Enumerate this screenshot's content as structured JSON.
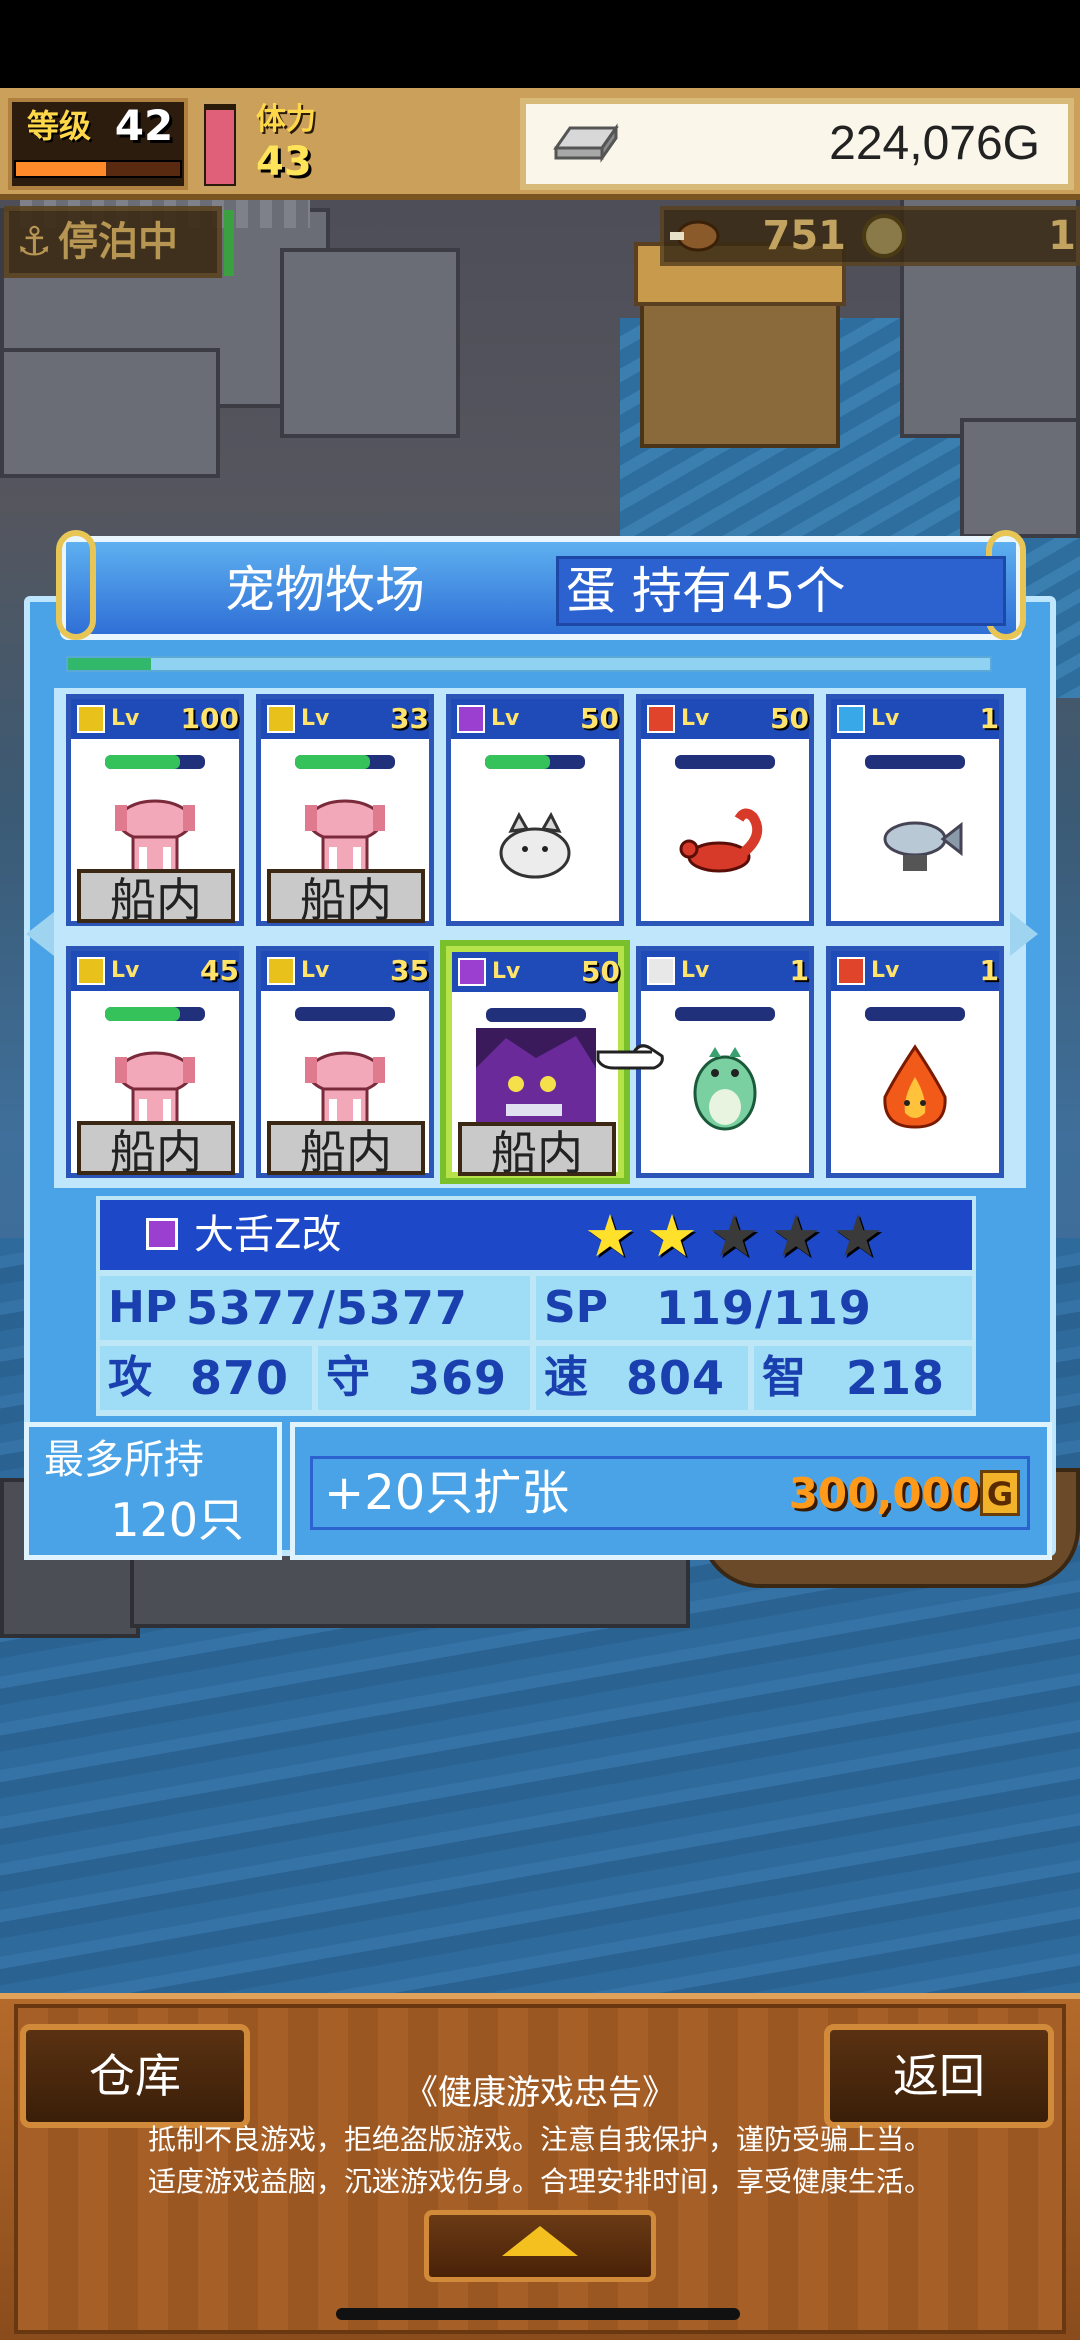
{
  "hud": {
    "level_label": "等级",
    "level_value": "42",
    "level_progress": 0.55,
    "hp_fill": 0.95,
    "stamina_label": "体力",
    "stamina_value": "43",
    "gold_value": "224,076G",
    "dock_status": "停泊中",
    "food_value": "751",
    "coin_value": "1"
  },
  "panel": {
    "title": "宠物牧场",
    "eggs_text": "蛋 持有45个",
    "page_progress": 0.09
  },
  "cards": [
    {
      "element": "gold",
      "lv_label": "Lv",
      "lv": "100",
      "hp": 0.75,
      "sprite": "pink-axolotl",
      "ship_label": "船内",
      "selected": false
    },
    {
      "element": "gold",
      "lv_label": "Lv",
      "lv": "33",
      "hp": 0.75,
      "sprite": "pink-axolotl",
      "ship_label": "船内",
      "selected": false
    },
    {
      "element": "purple",
      "lv_label": "Lv",
      "lv": "50",
      "hp": 0.65,
      "sprite": "white-slime",
      "ship_label": "",
      "selected": false
    },
    {
      "element": "red",
      "lv_label": "Lv",
      "lv": "50",
      "hp": 0,
      "sprite": "red-scorpion",
      "ship_label": "",
      "selected": false
    },
    {
      "element": "blue",
      "lv_label": "Lv",
      "lv": "1",
      "hp": 0,
      "sprite": "silver-fish",
      "ship_label": "",
      "selected": false
    },
    {
      "element": "gold",
      "lv_label": "Lv",
      "lv": "45",
      "hp": 0.75,
      "sprite": "pink-axolotl",
      "ship_label": "船内",
      "selected": false
    },
    {
      "element": "gold",
      "lv_label": "Lv",
      "lv": "35",
      "hp": 0,
      "sprite": "pink-axolotl",
      "ship_label": "船内",
      "selected": false
    },
    {
      "element": "purple",
      "lv_label": "Lv",
      "lv": "50",
      "hp": 0,
      "sprite": "purple-dragon",
      "ship_label": "船内",
      "selected": true
    },
    {
      "element": "white",
      "lv_label": "Lv",
      "lv": "1",
      "hp": 0,
      "sprite": "green-dino",
      "ship_label": "",
      "selected": false
    },
    {
      "element": "red",
      "lv_label": "Lv",
      "lv": "1",
      "hp": 0,
      "sprite": "fire-spirit",
      "ship_label": "",
      "selected": false
    }
  ],
  "info": {
    "name": "大舌Z改",
    "stars_filled": 2,
    "stars_total": 5,
    "hp_label": "HP",
    "hp_value": "5377/5377",
    "sp_label": "SP",
    "sp_value": "119/119",
    "atk_label": "攻",
    "atk_value": "870",
    "def_label": "守",
    "def_value": "369",
    "spd_label": "速",
    "spd_value": "804",
    "int_label": "智",
    "int_value": "218"
  },
  "capacity": {
    "label": "最多所持",
    "value": "120只",
    "expand_label": "+20只扩张",
    "expand_cost": "300,000",
    "cost_unit": "G"
  },
  "bottom": {
    "warehouse_label": "仓库",
    "back_label": "返回",
    "notice_title": "《健康游戏忠告》",
    "notice_line1": "抵制不良游戏，拒绝盗版游戏。注意自我保护，谨防受骗上当。",
    "notice_line2": "适度游戏益脑，沉迷游戏伤身。合理安排时间，享受健康生活。"
  },
  "colors": {
    "panel_blue": "#4aa3e6",
    "header_blue": "#2f6fd6",
    "card_border": "#2b56b8",
    "selected_border": "#b6e24a",
    "gold": "#ffe36a",
    "wood": "#9a5722"
  }
}
